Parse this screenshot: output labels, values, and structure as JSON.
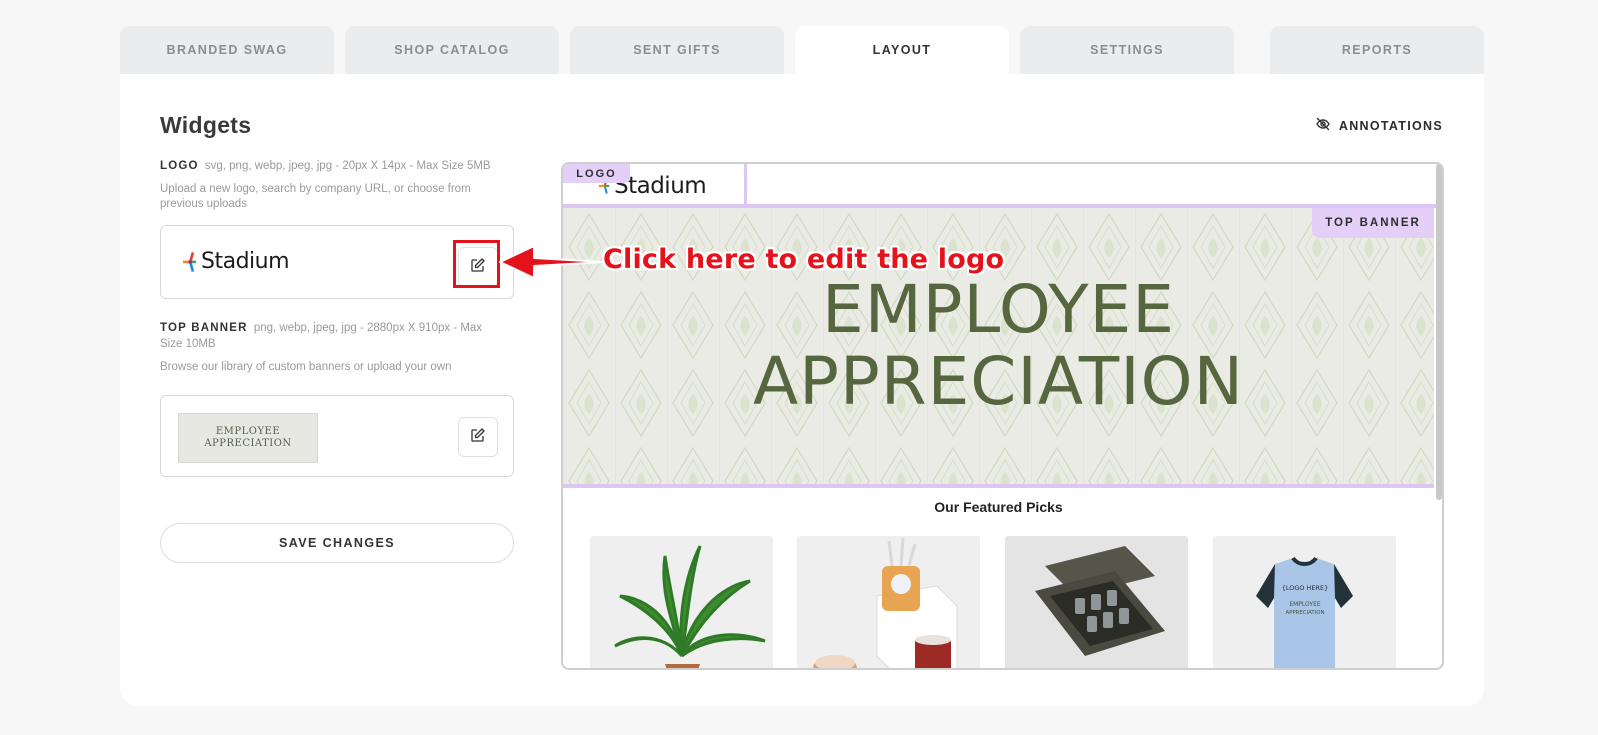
{
  "tabs": [
    {
      "label": "BRANDED SWAG",
      "active": false
    },
    {
      "label": "SHOP CATALOG",
      "active": false
    },
    {
      "label": "SENT GIFTS",
      "active": false
    },
    {
      "label": "LAYOUT",
      "active": true
    },
    {
      "label": "SETTINGS",
      "active": false
    },
    {
      "label": "REPORTS",
      "active": false
    }
  ],
  "widgets": {
    "title": "Widgets",
    "annotations_label": "ANNOTATIONS",
    "logo": {
      "label": "LOGO",
      "spec": "svg, png, webp, jpeg, jpg - 20px X 14px - Max Size 5MB",
      "description": "Upload a new logo, search by company URL, or choose from previous uploads",
      "brand_name": "Stadium"
    },
    "top_banner": {
      "label": "TOP BANNER",
      "spec": "png, webp, jpeg, jpg - 2880px X 910px - Max Size 10MB",
      "description": "Browse our library of custom banners or upload your own",
      "thumb_line1": "EMPLOYEE",
      "thumb_line2": "APPRECIATION"
    },
    "save_label": "SAVE CHANGES"
  },
  "preview": {
    "logo_tag": "LOGO",
    "brand_name": "Stadium",
    "banner_tag": "TOP BANNER",
    "banner_line1": "EMPLOYEE",
    "banner_line2": "APPRECIATION",
    "featured_title": "Our Featured Picks",
    "products": [
      {
        "name": "plant"
      },
      {
        "name": "desk-set"
      },
      {
        "name": "glassware-box"
      },
      {
        "name": "jersey",
        "line1": "{LOGO HERE}",
        "line2": "EMPLOYEE",
        "line3": "APPRECIATION"
      }
    ]
  },
  "callout": {
    "text": "Click here to edit the logo"
  },
  "colors": {
    "accent_lavender": "#dcc7f2",
    "callout_red": "#e5121b",
    "banner_green": "#56663f"
  }
}
